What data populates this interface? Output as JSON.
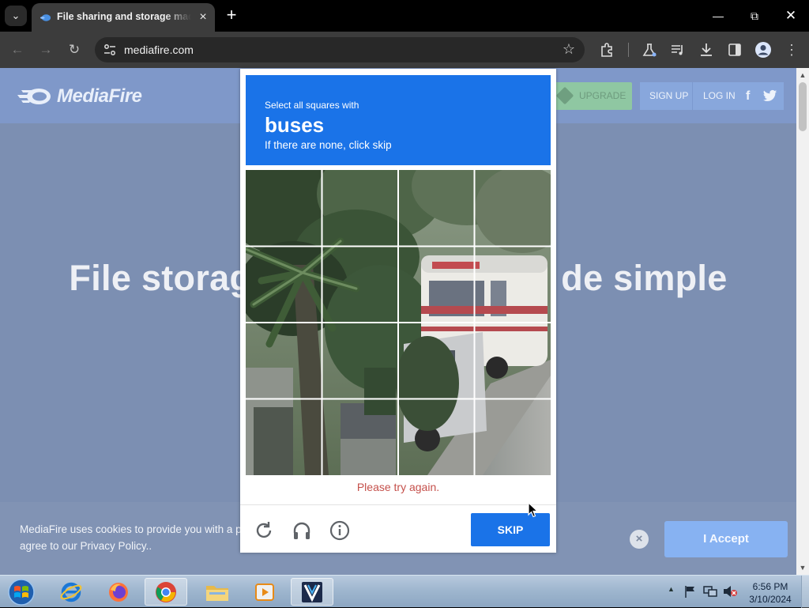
{
  "browser": {
    "tab_title": "File sharing and storage made simple",
    "url": "mediafire.com"
  },
  "site": {
    "logo_text": "MediaFire",
    "upgrade_label": "UPGRADE",
    "signup_label": "SIGN UP",
    "login_label": "LOG IN",
    "hero_left": "File storag",
    "hero_right": "de simple"
  },
  "cookie": {
    "line1": "MediaFire uses cookies to provide you with a p",
    "line2": "agree to our Privacy Policy..",
    "close_label": "×",
    "accept_label": "I Accept"
  },
  "captcha": {
    "instruction_line1": "Select all squares with",
    "target": "buses",
    "instruction_line2": "If there are none, click skip",
    "error": "Please try again.",
    "skip_label": "SKIP",
    "colors": {
      "accent": "#1a73e8",
      "error": "#c5504b"
    }
  },
  "taskbar": {
    "apps": [
      "internet-explorer",
      "firefox",
      "chrome",
      "file-explorer",
      "media-player",
      "vpn-app"
    ],
    "time": "6:56 PM",
    "date": "3/10/2024"
  }
}
